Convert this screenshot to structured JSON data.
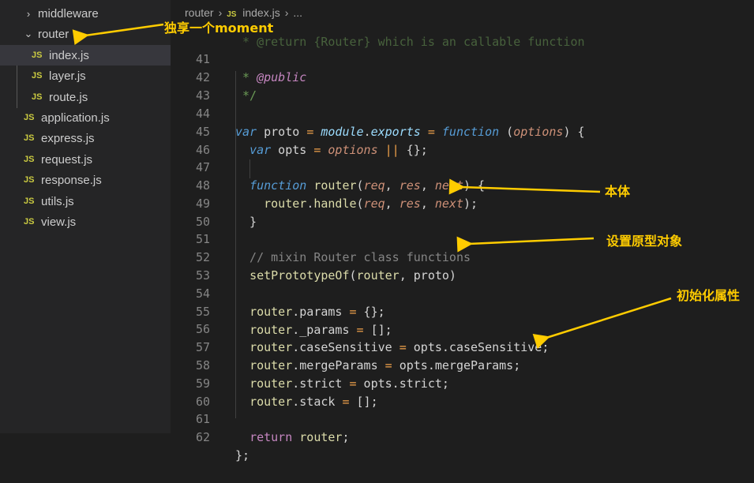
{
  "sidebar": {
    "items": [
      {
        "label": "middleware",
        "kind": "folder",
        "expanded": false
      },
      {
        "label": "router",
        "kind": "folder",
        "expanded": true
      },
      {
        "label": "index.js",
        "kind": "js",
        "selected": true
      },
      {
        "label": "layer.js",
        "kind": "js"
      },
      {
        "label": "route.js",
        "kind": "js"
      },
      {
        "label": "application.js",
        "kind": "js"
      },
      {
        "label": "express.js",
        "kind": "js"
      },
      {
        "label": "request.js",
        "kind": "js"
      },
      {
        "label": "response.js",
        "kind": "js"
      },
      {
        "label": "utils.js",
        "kind": "js"
      },
      {
        "label": "view.js",
        "kind": "js"
      }
    ],
    "js_badge": "JS"
  },
  "breadcrumb": {
    "folder": "router",
    "file": "index.js",
    "more": "..."
  },
  "editor": {
    "lines": [
      {
        "n": "41",
        "text": " * @public"
      },
      {
        "n": "42",
        "text": " */"
      },
      {
        "n": "43",
        "text": ""
      },
      {
        "n": "44",
        "text": "var proto = module.exports = function (options) {"
      },
      {
        "n": "45",
        "text": "  var opts = options || {};"
      },
      {
        "n": "46",
        "text": ""
      },
      {
        "n": "47",
        "text": "  function router(req, res, next) {"
      },
      {
        "n": "48",
        "text": "    router.handle(req, res, next);"
      },
      {
        "n": "49",
        "text": "  }"
      },
      {
        "n": "50",
        "text": ""
      },
      {
        "n": "51",
        "text": "  // mixin Router class functions"
      },
      {
        "n": "52",
        "text": "  setPrototypeOf(router, proto)"
      },
      {
        "n": "53",
        "text": ""
      },
      {
        "n": "54",
        "text": "  router.params = {};"
      },
      {
        "n": "55",
        "text": "  router._params = [];"
      },
      {
        "n": "56",
        "text": "  router.caseSensitive = opts.caseSensitive;"
      },
      {
        "n": "57",
        "text": "  router.mergeParams = opts.mergeParams;"
      },
      {
        "n": "58",
        "text": "  router.strict = opts.strict;"
      },
      {
        "n": "59",
        "text": "  router.stack = [];"
      },
      {
        "n": "60",
        "text": ""
      },
      {
        "n": "61",
        "text": "  return router;"
      },
      {
        "n": "62",
        "text": "};"
      }
    ],
    "partial_top_line": " * @return {Router} which is an callable function"
  },
  "annotations": {
    "exclusive_moment": "独享一个moment",
    "body": "本体",
    "set_prototype": "设置原型对象",
    "init_props": "初始化属性"
  },
  "colors": {
    "annotation": "#ffcc00",
    "sidebar_bg": "#252526",
    "editor_bg": "#1e1e1e"
  }
}
